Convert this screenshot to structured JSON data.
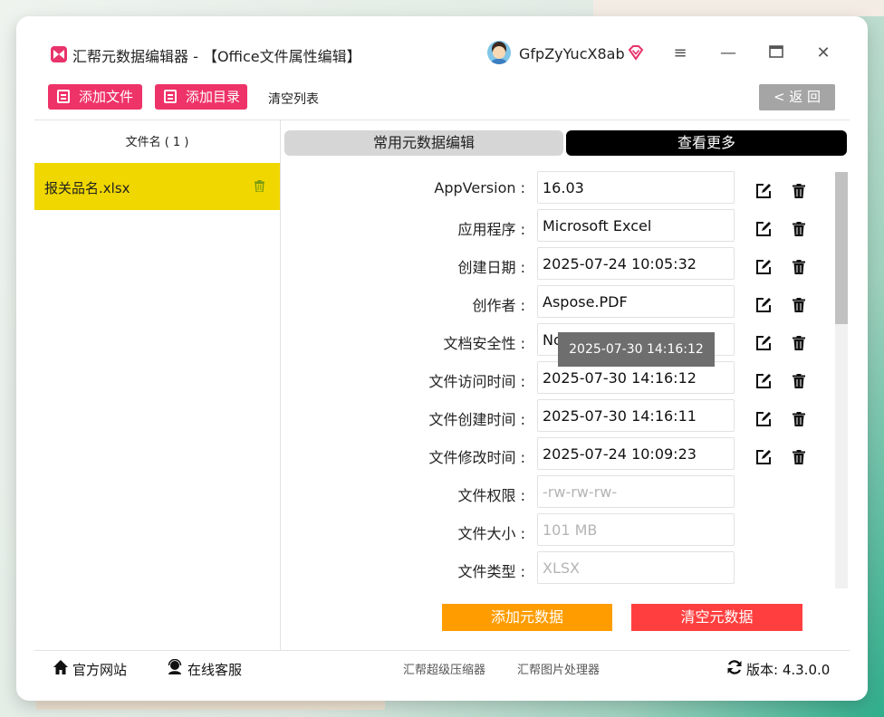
{
  "app": {
    "title": "汇帮元数据编辑器 - 【Office文件属性编辑】",
    "username": "GfpZyYucX8ab"
  },
  "window_controls": {
    "menu": "≡",
    "minimize": "—",
    "maximize": "□",
    "close": "✕"
  },
  "toolbar": {
    "add_file": "添加文件",
    "add_dir": "添加目录",
    "clear_list": "清空列表",
    "back": "< 返 回"
  },
  "file_list": {
    "header": "文件名 ( 1 )",
    "items": [
      {
        "name": "报关品名.xlsx"
      }
    ]
  },
  "tabs": {
    "common": "常用元数据编辑",
    "more": "查看更多"
  },
  "metadata": {
    "rows": [
      {
        "label": "AppVersion :",
        "value": "16.03"
      },
      {
        "label": "应用程序 :",
        "value": "Microsoft Excel"
      },
      {
        "label": "创建日期 :",
        "value": "2025-07-24 10:05:32"
      },
      {
        "label": "创作者 :",
        "value": "Aspose.PDF"
      },
      {
        "label": "文档安全性 :",
        "value": "None"
      },
      {
        "label": "文件访问时间 :",
        "value": "2025-07-30 14:16:12"
      },
      {
        "label": "文件创建时间 :",
        "value": "2025-07-30 14:16:11"
      },
      {
        "label": "文件修改时间 :",
        "value": "2025-07-24 10:09:23"
      },
      {
        "label": "文件权限 :",
        "value": "-rw-rw-rw-"
      },
      {
        "label": "文件大小 :",
        "value": "101 MB"
      },
      {
        "label": "文件类型 :",
        "value": "XLSX"
      }
    ],
    "tooltip": "2025-07-30 14:16:12"
  },
  "actions": {
    "add_meta": "添加元数据",
    "clear_meta": "清空元数据"
  },
  "footer": {
    "website": "官方网站",
    "support": "在线客服",
    "compressor": "汇帮超级压缩器",
    "image_tool": "汇帮图片处理器",
    "version": "版本:  4.3.0.0"
  },
  "colors": {
    "accent_pink": "#ee3368",
    "selected_yellow": "#f0d700",
    "orange": "#ff9d00",
    "red": "#ff3f3f"
  }
}
